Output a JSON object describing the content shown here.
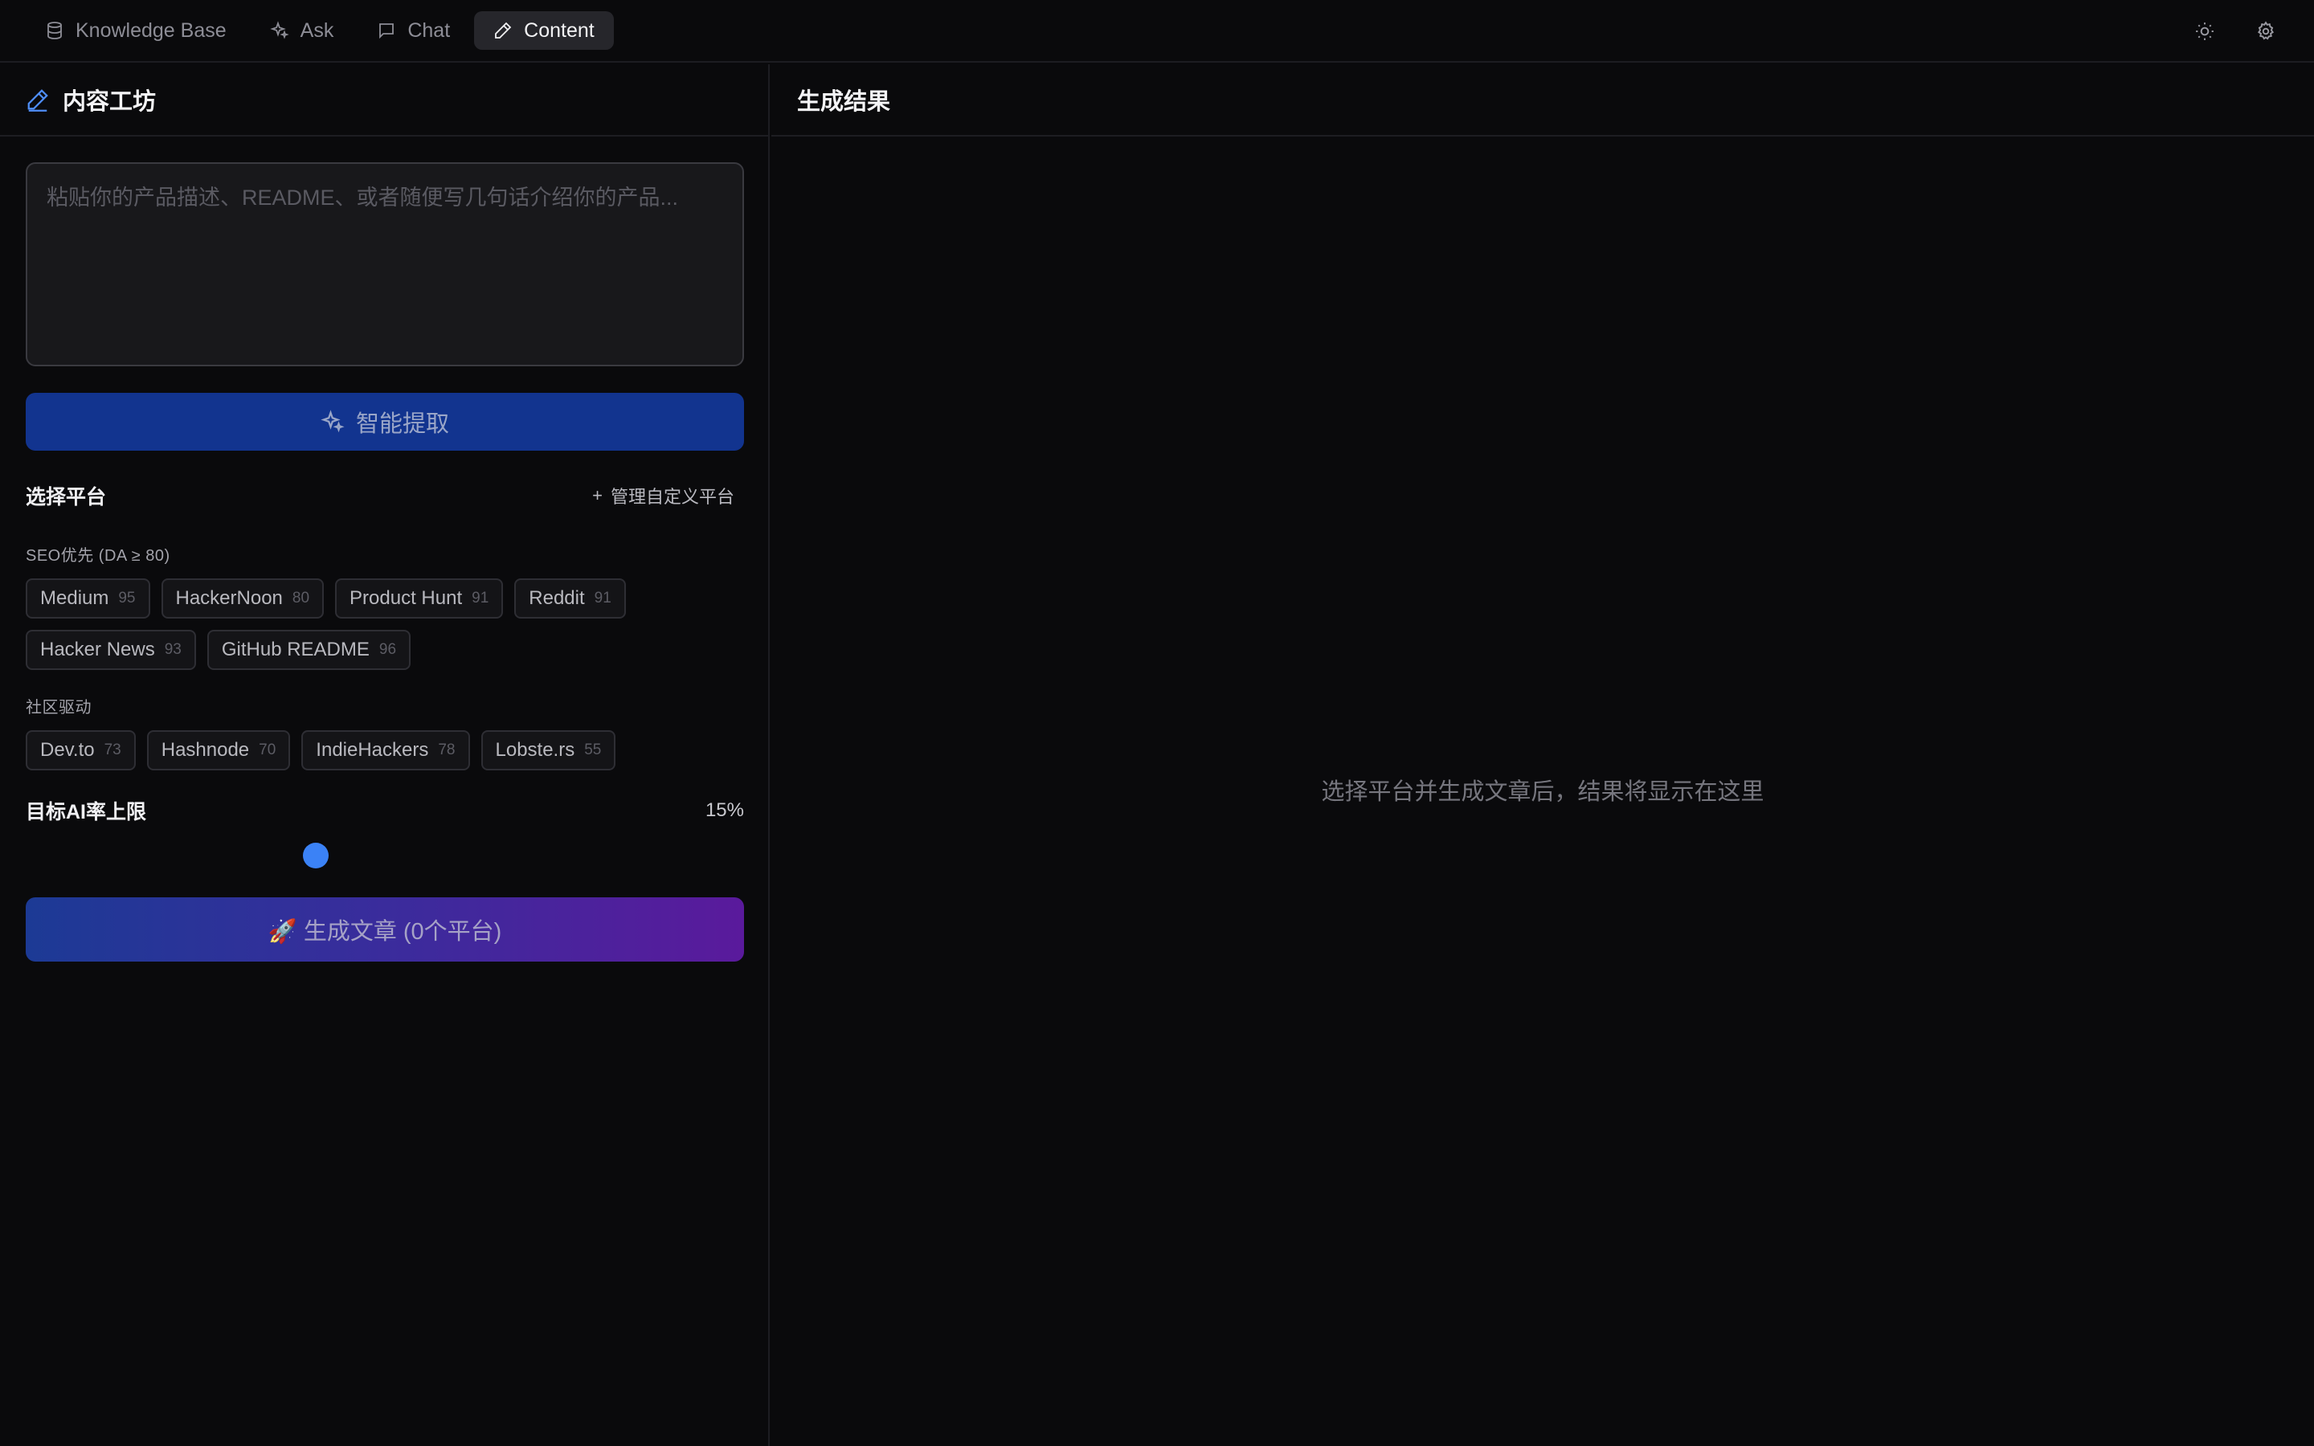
{
  "nav": {
    "items": [
      {
        "label": "Knowledge Base",
        "icon": "database-icon",
        "active": false
      },
      {
        "label": "Ask",
        "icon": "sparkles-icon",
        "active": false
      },
      {
        "label": "Chat",
        "icon": "message-icon",
        "active": false
      },
      {
        "label": "Content",
        "icon": "pen-icon",
        "active": true
      }
    ],
    "right_icons": [
      "sun-icon",
      "gear-icon"
    ]
  },
  "left": {
    "title": "内容工坊",
    "input": {
      "value": "",
      "placeholder": "粘贴你的产品描述、README、或者随便写几句话介绍你的产品..."
    },
    "extract_label": "智能提取",
    "platforms_title": "选择平台",
    "manage_label": "管理自定义平台",
    "groups": [
      {
        "label": "SEO优先 (DA ≥ 80)",
        "platforms": [
          {
            "name": "Medium",
            "score": "95"
          },
          {
            "name": "HackerNoon",
            "score": "80"
          },
          {
            "name": "Product Hunt",
            "score": "91"
          },
          {
            "name": "Reddit",
            "score": "91"
          },
          {
            "name": "Hacker News",
            "score": "93"
          },
          {
            "name": "GitHub README",
            "score": "96"
          }
        ]
      },
      {
        "label": "社区驱动",
        "platforms": [
          {
            "name": "Dev.to",
            "score": "73"
          },
          {
            "name": "Hashnode",
            "score": "70"
          },
          {
            "name": "IndieHackers",
            "score": "78"
          },
          {
            "name": "Lobste.rs",
            "score": "55"
          }
        ]
      }
    ],
    "rate_title": "目标AI率上限",
    "rate_value": "15%",
    "slider_fraction": 0.4,
    "generate_label": "🚀 生成文章 (0个平台)"
  },
  "right": {
    "title": "生成结果",
    "empty_message": "选择平台并生成文章后，结果将显示在这里"
  },
  "colors": {
    "background": "#0a0a0c",
    "accent": "#3b82f6",
    "extract_button": "#12348f",
    "generate_gradient_start": "#1c3a95",
    "generate_gradient_end": "#5a1a9c"
  }
}
